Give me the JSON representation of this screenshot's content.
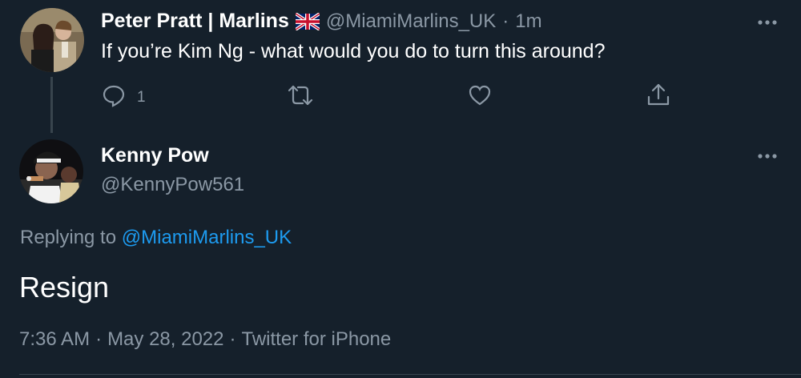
{
  "colors": {
    "background": "#15202b",
    "text_primary": "#ffffff",
    "text_secondary": "#8b98a5",
    "link": "#1d9bf0",
    "divider": "#38444d"
  },
  "parent_tweet": {
    "display_name": "Peter Pratt | Marlins",
    "flag": "🇬🇧",
    "handle": "@MiamiMarlins_UK",
    "separator": "·",
    "time": "1m",
    "text": "If you’re Kim Ng - what would you do to turn this around?",
    "more_icon": "more-horizontal-icon",
    "actions": {
      "reply_icon": "reply-icon",
      "reply_count": "1",
      "retweet_icon": "retweet-icon",
      "like_icon": "heart-icon",
      "share_icon": "share-icon"
    }
  },
  "reply_tweet": {
    "display_name": "Kenny Pow",
    "handle": "@KennyPow561",
    "more_icon": "more-horizontal-icon",
    "replying_to_prefix": "Replying to",
    "replying_to_handle": "@MiamiMarlins_UK",
    "text": "Resign",
    "time": "7:36 AM",
    "sep1": "·",
    "date": "May 28, 2022",
    "sep2": "·",
    "source": "Twitter for iPhone"
  }
}
